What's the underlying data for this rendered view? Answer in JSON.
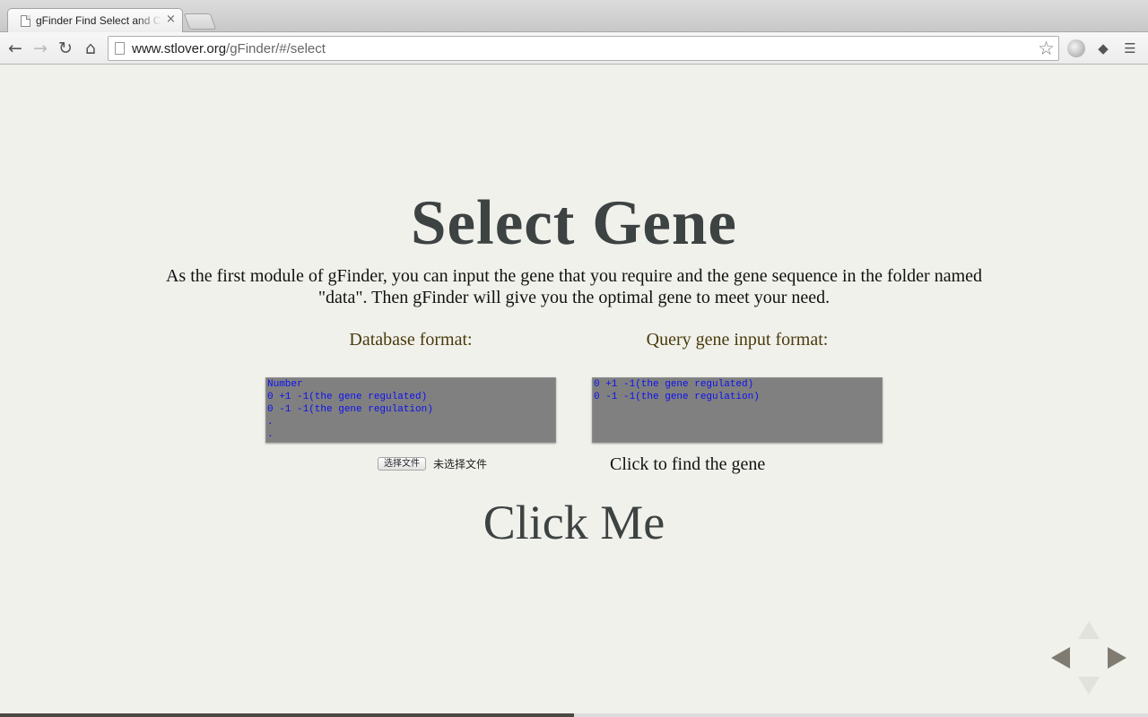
{
  "browser": {
    "tab_title": "gFinder Find Select and Create",
    "tab_close": "×",
    "url_host": "www.stlover.org",
    "url_path": "/gFinder/#/select",
    "back_icon": "←",
    "forward_icon": "→",
    "reload_icon": "↻",
    "home_icon": "⌂",
    "star_icon": "☆",
    "menu_icon": "☰",
    "ext_icon": "◆"
  },
  "slide": {
    "title": "Select Gene",
    "intro": "As the first module of gFinder, you can input the gene that you require and the gene sequence in the folder named \"data\". Then gFinder will give you the optimal gene to meet your need.",
    "database_label": "Database format:",
    "query_label": "Query gene input format:",
    "database_lines": [
      "Number",
      "0 +1 -1(the gene regulated)",
      "0 -1 -1(the gene regulation)",
      ".",
      "."
    ],
    "query_lines": [
      "0 +1 -1(the gene regulated)",
      "0 -1 -1(the gene regulation)"
    ],
    "file_button": "选择文件",
    "file_status": "未选择文件",
    "find_text": "Click to find the gene",
    "click_me": "Click Me"
  },
  "navigation": {
    "progress_fraction": 0.5
  }
}
